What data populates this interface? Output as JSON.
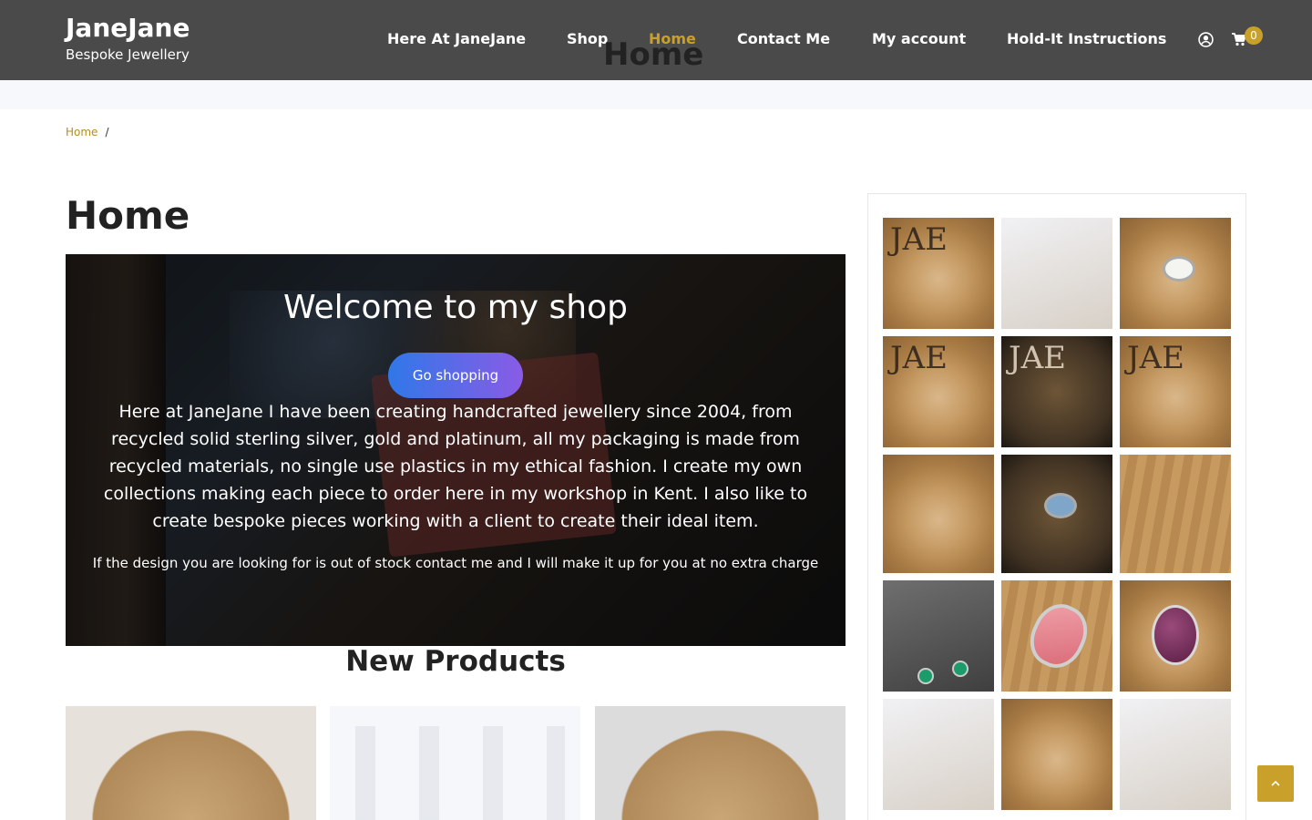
{
  "brand": {
    "title": "JaneJane",
    "subtitle": "Bespoke Jewellery"
  },
  "nav": {
    "items": [
      {
        "label": "Here At JaneJane"
      },
      {
        "label": "Shop"
      },
      {
        "label": "Home",
        "active": true
      },
      {
        "label": "Contact Me"
      },
      {
        "label": "My account"
      },
      {
        "label": "Hold-It Instructions"
      }
    ],
    "ghost_title": "Home",
    "cart_count": "0"
  },
  "breadcrumb": {
    "home": "Home",
    "separator": "/"
  },
  "page": {
    "title": "Home"
  },
  "hero": {
    "title": "Welcome to my shop",
    "button": "Go shopping",
    "text": "Here at JaneJane I have been creating handcrafted jewellery since 2004, from recycled solid sterling silver, gold and platinum, all my packaging is made from recycled materials, no single use plastics in my ethical fashion. I create my own collections making each piece to order here in my workshop in Kent. I also like to create bespoke pieces working with a client to create their ideal item.",
    "note": "If the design you are looking for is out of stock contact me and I will make it up for you at no extra charge"
  },
  "sections": {
    "new_products": "New Products"
  },
  "colors": {
    "header_bg": "#4a4a4a",
    "accent": "#c9a02a",
    "button_gradient_start": "#2f78e8",
    "button_gradient_end": "#8a5be6"
  },
  "gallery": {
    "thumbs": [
      "jewellery-photo",
      "jewellery-photo",
      "jewellery-photo",
      "jewellery-photo",
      "jewellery-photo",
      "jewellery-photo",
      "jewellery-photo",
      "jewellery-photo",
      "jewellery-photo",
      "jewellery-photo",
      "jewellery-photo",
      "jewellery-photo",
      "jewellery-photo",
      "jewellery-photo",
      "jewellery-photo"
    ]
  }
}
